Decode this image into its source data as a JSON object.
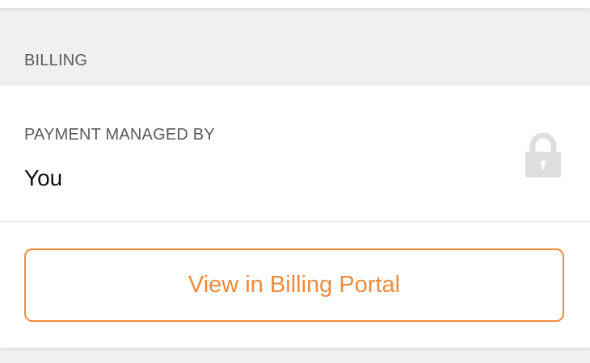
{
  "billing": {
    "section_title": "BILLING",
    "payment_label": "PAYMENT MANAGED BY",
    "payment_value": "You",
    "lock_icon": "lock-icon",
    "portal_button_label": "View in Billing Portal"
  },
  "colors": {
    "accent": "#f08a3c",
    "background": "#f0f0f0",
    "card": "#ffffff",
    "lock": "#dedede"
  }
}
